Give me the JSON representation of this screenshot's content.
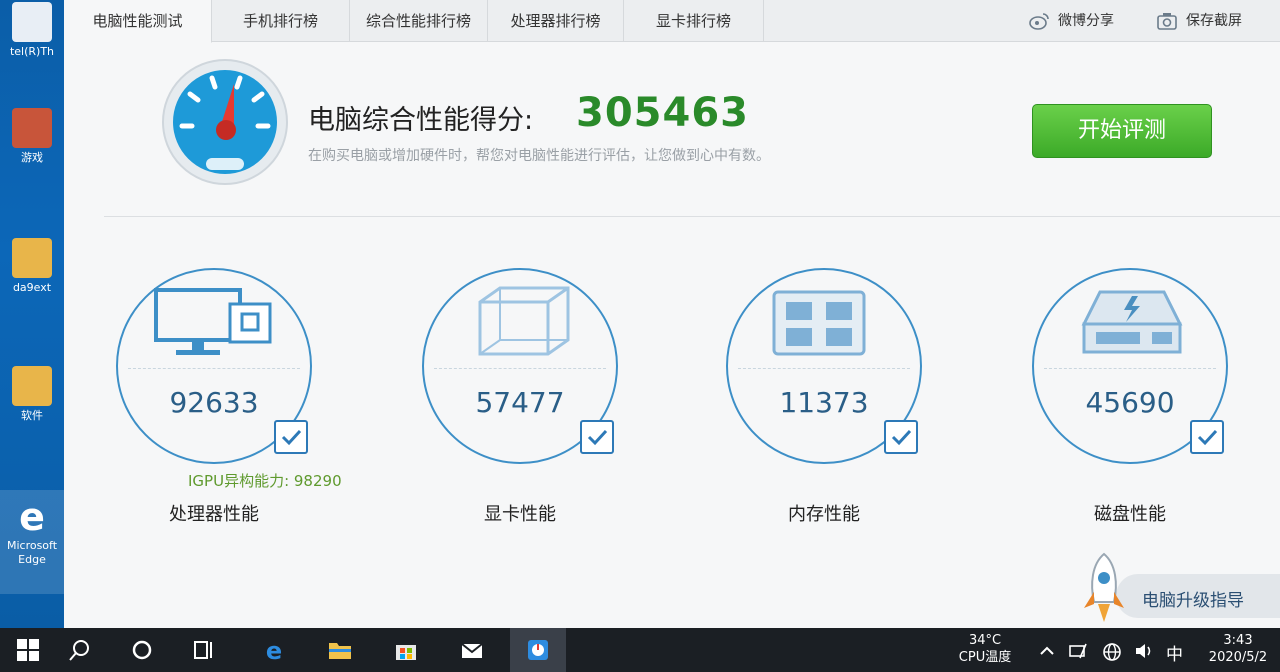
{
  "desktop": {
    "icons": [
      {
        "label": "tel(R)Th"
      },
      {
        "label": "游戏"
      },
      {
        "label": "da9ext"
      },
      {
        "label": "软件"
      },
      {
        "label": "Microsoft Edge"
      }
    ]
  },
  "tabs": [
    {
      "label": "电脑性能测试",
      "active": true
    },
    {
      "label": "手机排行榜"
    },
    {
      "label": "综合性能排行榜"
    },
    {
      "label": "处理器排行榜"
    },
    {
      "label": "显卡排行榜"
    }
  ],
  "toolbar": {
    "share_label": "微博分享",
    "screenshot_label": "保存截屏"
  },
  "header": {
    "score_label": "电脑综合性能得分:",
    "score_value": "305463",
    "subtitle": "在购买电脑或增加硬件时，帮您对电脑性能进行评估，让您做到心中有数。",
    "start_button": "开始评测"
  },
  "metrics": [
    {
      "name": "处理器性能",
      "value": "92633",
      "checked": true,
      "icon": "cpu-monitor-icon"
    },
    {
      "name": "显卡性能",
      "value": "57477",
      "checked": true,
      "icon": "gpu-cube-icon"
    },
    {
      "name": "内存性能",
      "value": "11373",
      "checked": true,
      "icon": "memory-chip-icon"
    },
    {
      "name": "磁盘性能",
      "value": "45690",
      "checked": true,
      "icon": "disk-drive-icon"
    }
  ],
  "igpu_note": "IGPU异构能力: 98290",
  "upgrade_guide": "电脑升级指导",
  "taskbar": {
    "temperature": "34°C",
    "temperature_label": "CPU温度",
    "ime": "中",
    "time": "3:43",
    "date": "2020/5/2"
  },
  "colors": {
    "accent_blue": "#3d8fc7",
    "score_green": "#2a8a2a",
    "button_green": "#3caa28"
  }
}
